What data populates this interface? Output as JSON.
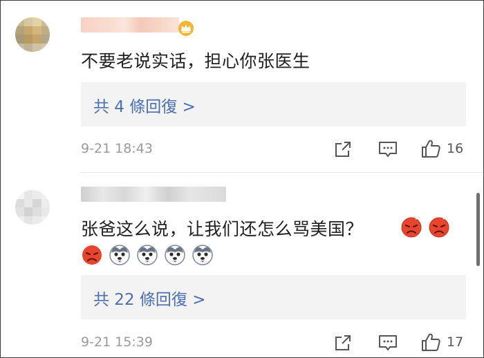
{
  "comments": [
    {
      "text": "不要老说实话，担心你张医生",
      "reply_link": "共 4 條回復 >",
      "time": "9-21 18:43",
      "like_count": "16",
      "icons": [
        "share-icon",
        "comment-icon",
        "thumbs-up-icon",
        "crown-badge-icon"
      ]
    },
    {
      "text": "张爸这么说，让我们还怎么骂美国？",
      "reply_link": "共 22 條回復 >",
      "time": "9-21 15:39",
      "like_count": "17",
      "icons": [
        "share-icon",
        "comment-icon",
        "thumbs-up-icon",
        "angry-face-emoji",
        "husky-dog-emoji"
      ]
    }
  ],
  "colors": {
    "link": "#4b6fb1",
    "reply_box": "#f3f3f3",
    "meta_text": "#9a9a9a"
  }
}
